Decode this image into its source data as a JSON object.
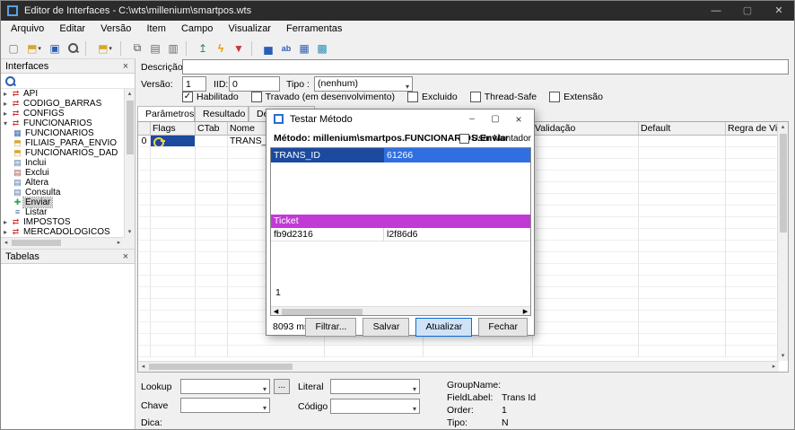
{
  "window": {
    "title": "Editor de Interfaces - C:\\wts\\millenium\\smartpos.wts",
    "controls": {
      "minimize": "—",
      "maximize": "▢",
      "close": "✕"
    }
  },
  "menu": {
    "items": [
      "Arquivo",
      "Editar",
      "Versão",
      "Item",
      "Campo",
      "Visualizar",
      "Ferramentas"
    ]
  },
  "toolbar": {
    "icons": [
      {
        "name": "new-file",
        "glyph": "▢"
      },
      {
        "name": "open-file",
        "glyph": "⬒"
      },
      {
        "name": "save",
        "glyph": "▣"
      },
      {
        "name": "folder",
        "glyph": "⬒"
      },
      {
        "name": "copy",
        "glyph": "⧉"
      },
      {
        "name": "paste",
        "glyph": "▤"
      },
      {
        "name": "clipboard",
        "glyph": "▥"
      },
      {
        "name": "up-arrow",
        "glyph": "↥"
      },
      {
        "name": "lightning",
        "glyph": "ϟ"
      },
      {
        "name": "filter-funnel",
        "glyph": "▼"
      },
      {
        "name": "chart",
        "glyph": "▅"
      },
      {
        "name": "letters",
        "glyph": "ab"
      },
      {
        "name": "table",
        "glyph": "▦"
      },
      {
        "name": "grid",
        "glyph": "▩"
      }
    ]
  },
  "panels": {
    "interfaces_title": "Interfaces",
    "tabelas_title": "Tabelas",
    "close_icon": "×"
  },
  "tree": {
    "items": [
      {
        "label": "API"
      },
      {
        "label": "CODIGO_BARRAS"
      },
      {
        "label": "CONFIGS"
      },
      {
        "label": "FUNCIONARIOS"
      },
      {
        "label": "FUNCIONARIOS"
      },
      {
        "label": "FILIAIS_PARA_ENVIO"
      },
      {
        "label": "FUNCIONARIOS_DAD"
      },
      {
        "label": "Inclui"
      },
      {
        "label": "Exclui"
      },
      {
        "label": "Altera"
      },
      {
        "label": "Consulta"
      },
      {
        "label": "Enviar"
      },
      {
        "label": "Listar"
      },
      {
        "label": "IMPOSTOS"
      },
      {
        "label": "MERCADOLOGICOS"
      }
    ]
  },
  "editor": {
    "descricao_label": "Descrição:",
    "descricao_value": "",
    "versao_label": "Versão:",
    "versao_value": "1",
    "iid_label": "IID:",
    "iid_value": "0",
    "tipo_label": "Tipo :",
    "tipo_value": "(nenhum)",
    "checks": [
      {
        "label": "Habilitado",
        "mark": "✓"
      },
      {
        "label": "Travado (em desenvolvimento)",
        "mark": ""
      },
      {
        "label": "Excluido",
        "mark": ""
      },
      {
        "label": "Thread-Safe",
        "mark": ""
      },
      {
        "label": "Extensão",
        "mark": ""
      }
    ],
    "tabs": [
      {
        "label": "Parâmetros"
      },
      {
        "label": "Resultado"
      },
      {
        "label": "Dependentes"
      }
    ],
    "grid": {
      "columns": [
        "",
        "Flags",
        "CTab",
        "Nome",
        "",
        "",
        "Validação",
        "Default",
        "Regra de Visibilidade"
      ],
      "row0_index": "0",
      "row0_nome": "TRANS_ID"
    },
    "footer": {
      "lookup_label": "Lookup",
      "chave_label": "Chave",
      "dica_label": "Dica:",
      "literal_label": "Literal",
      "codigo_label": "Código",
      "more_button": "...",
      "groupname_label": "GroupName:",
      "groupname_value": "",
      "fieldlabel_label": "FieldLabel:",
      "fieldlabel_value": "Trans Id",
      "order_label": "Order:",
      "order_value": "1",
      "tipo_label": "Tipo:",
      "tipo_value": "N"
    }
  },
  "dialog": {
    "title": "Testar Método",
    "controls": {
      "minimize": "–",
      "maximize": "▢",
      "close": "×"
    },
    "metodo_label": "Método:",
    "metodo_value": "millenium\\smartpos.FUNCIONARIOS.Enviar",
    "usar_montador_label": "Usar Montador",
    "param_name": "TRANS_ID",
    "param_value": "61266",
    "ticket_header": "Ticket",
    "ticket_name": "fb9d2316",
    "ticket_value": "l2f86d6",
    "row_indicator": "1",
    "elapsed": "8093 ms",
    "buttons": [
      {
        "label": "Filtrar..."
      },
      {
        "label": "Salvar"
      },
      {
        "label": "Atualizar"
      },
      {
        "label": "Fechar"
      }
    ]
  },
  "ui": {
    "caret": "▾",
    "chev_collapsed": "▸",
    "chev_expanded": "▾",
    "scroll_left": "◂",
    "scroll_right": "▸",
    "scroll_up": "▴",
    "scroll_down": "▾",
    "iface_icon": "⇄",
    "folder_icon": "⬒",
    "grid_icon": "▦",
    "doc_icon": "▤",
    "enviar_icon": "✚",
    "listar_icon": "≡"
  },
  "colors": {
    "titlebar": "#2b2b2b",
    "selection_blue_dark": "#1b4a9e",
    "selection_blue_bright": "#2f6fe0",
    "ticket_magenta": "#c23ad6",
    "default_button_border": "#0a6cd6",
    "key_yellow": "#ffd24a"
  }
}
